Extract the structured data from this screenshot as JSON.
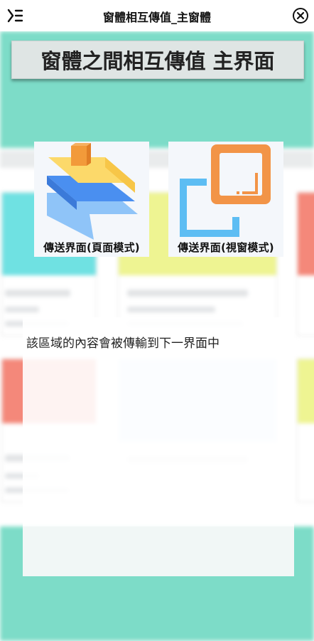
{
  "window": {
    "title": "窗體相互傳值_主窗體",
    "menu_icon": "menu-icon",
    "close_icon": "close-icon"
  },
  "banner": {
    "title": "窗體之間相互傳值 主界面"
  },
  "tiles": [
    {
      "label": "傳送界面(頁面模式)",
      "icon": "page-mode-icon"
    },
    {
      "label": "傳送界面(視窗模式)",
      "icon": "window-mode-icon"
    }
  ],
  "transfer_area": {
    "text": "該區域的內容會被傳輸到下一界面中"
  },
  "colors": {
    "accent_teal": "#7ddcc8",
    "tile_bg": "#f4f7fb",
    "banner_bg": "#dfe5e4"
  }
}
